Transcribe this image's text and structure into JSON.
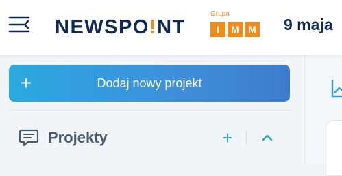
{
  "header": {
    "brand": {
      "prefix": "NEWSPO",
      "dot_char": "!",
      "suffix": "NT"
    },
    "group": {
      "label": "Grupa",
      "letters": [
        "I",
        "M",
        "M"
      ]
    },
    "date": "9 maja"
  },
  "sidebar": {
    "add_project_label": "Dodaj nowy projekt",
    "add_symbol": "+",
    "projects": {
      "title": "Projekty",
      "add_symbol": "+"
    }
  },
  "icons": {
    "menu": "menu-collapse-icon",
    "add": "plus-icon",
    "projects": "chat-bubble-icon",
    "collapse": "chevron-up-icon",
    "chart": "chart-line-icon"
  },
  "colors": {
    "brand_navy": "#0f2b55",
    "brand_orange": "#f08b1e",
    "button_gradient_start": "#2aa9e0",
    "button_gradient_end": "#3d7ccd",
    "accent_blue": "#2f9edb"
  }
}
